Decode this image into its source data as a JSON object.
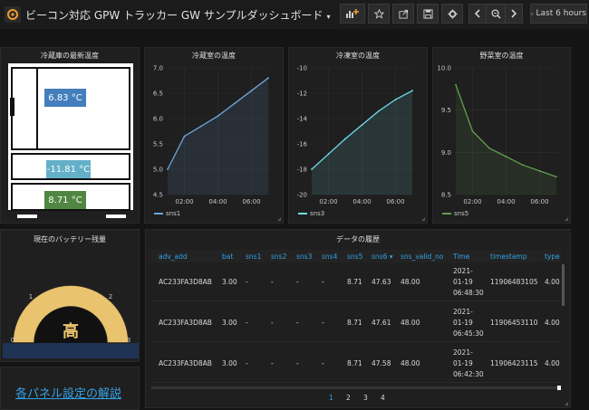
{
  "navbar": {
    "title": "ビーコン対応 GPW トラッカー GW サンプルダッシュボード",
    "caret": "▾",
    "time_range": "Last 6 hours",
    "icons": [
      "add-panel-icon",
      "star-icon",
      "share-icon",
      "save-icon",
      "settings-icon",
      "chevron-left-icon",
      "zoom-out-icon",
      "chevron-right-icon",
      "clock-icon"
    ]
  },
  "fridge": {
    "title": "冷蔵庫の最新温度",
    "fridge_reading": "6.83 °C",
    "freezer_reading": "-11.81 °C",
    "veg_reading": "8.71 °C",
    "colors": {
      "fridge": "#447ebc",
      "freezer": "#64b0c8",
      "veg": "#508642"
    }
  },
  "charts": {
    "fridge": {
      "title": "冷蔵室の温度",
      "yticks": [
        "7.0",
        "6.5",
        "6.0",
        "5.5",
        "5.0",
        "4.5"
      ],
      "xticks": [
        "02:00",
        "04:00",
        "06:00"
      ],
      "legend": "sns1",
      "color": "#6ea6dd"
    },
    "freezer": {
      "title": "冷凍室の温度",
      "yticks": [
        "-10",
        "-12",
        "-14",
        "-16",
        "-18",
        "-20"
      ],
      "xticks": [
        "02:00",
        "04:00",
        "06:00"
      ],
      "legend": "sns3",
      "color": "#70dbed"
    },
    "veg": {
      "title": "野菜室の温度",
      "yticks": [
        "10.0",
        "9.5",
        "9.0",
        "8.5"
      ],
      "xticks": [
        "02:00",
        "04:00",
        "06:00"
      ],
      "legend": "sns5",
      "color": "#629e51"
    }
  },
  "chart_data": [
    {
      "type": "line",
      "title": "冷蔵室の温度",
      "ylim": [
        4.5,
        7.0
      ],
      "x": [
        "01:00",
        "02:00",
        "03:00",
        "04:00",
        "05:00",
        "06:00",
        "06:48"
      ],
      "series": [
        {
          "name": "sns1",
          "values": [
            5.0,
            5.65,
            5.85,
            6.05,
            6.3,
            6.55,
            6.8
          ]
        }
      ]
    },
    {
      "type": "line",
      "title": "冷凍室の温度",
      "ylim": [
        -20,
        -10
      ],
      "x": [
        "01:00",
        "02:00",
        "03:00",
        "04:00",
        "05:00",
        "06:00",
        "06:48"
      ],
      "series": [
        {
          "name": "sns3",
          "values": [
            -18.0,
            -16.8,
            -15.6,
            -14.5,
            -13.4,
            -12.5,
            -11.8
          ]
        }
      ]
    },
    {
      "type": "line",
      "title": "野菜室の温度",
      "ylim": [
        8.5,
        10.0
      ],
      "x": [
        "01:00",
        "02:00",
        "03:00",
        "04:00",
        "05:00",
        "06:00",
        "06:48"
      ],
      "series": [
        {
          "name": "sns5",
          "values": [
            9.8,
            9.25,
            9.05,
            8.95,
            8.85,
            8.78,
            8.71
          ]
        }
      ]
    }
  ],
  "battery": {
    "title": "現在のバッテリー残量",
    "value": "高",
    "ticks": [
      "0",
      "1",
      "2",
      "3"
    ]
  },
  "history": {
    "title": "データの履歴",
    "columns": [
      "adv_add",
      "bat",
      "sns1",
      "sns2",
      "sns3",
      "sns4",
      "sns5",
      "sns6 ▾",
      "sns_valid_no",
      "Time",
      "timestamp",
      "type"
    ],
    "rows": [
      {
        "adv_add": "AC233FA3D8AB",
        "bat": "3.00",
        "sns1": "-",
        "sns2": "-",
        "sns3": "-",
        "sns4": "-",
        "sns5": "8.71",
        "sns6": "47.63",
        "valid": "48.00",
        "time1": "2021-",
        "time2": "01-19",
        "time3": "06:48:30",
        "timestamp": "11906483105",
        "type": "4.00"
      },
      {
        "adv_add": "AC233FA3D8AB",
        "bat": "3.00",
        "sns1": "-",
        "sns2": "-",
        "sns3": "-",
        "sns4": "-",
        "sns5": "8.71",
        "sns6": "47.61",
        "valid": "48.00",
        "time1": "2021-",
        "time2": "01-19",
        "time3": "06:45:30",
        "timestamp": "11906453110",
        "type": "4.00"
      },
      {
        "adv_add": "AC233FA3D8AB",
        "bat": "3.00",
        "sns1": "-",
        "sns2": "-",
        "sns3": "-",
        "sns4": "-",
        "sns5": "8.71",
        "sns6": "47.58",
        "valid": "48.00",
        "time1": "2021-",
        "time2": "01-19",
        "time3": "06:42:30",
        "timestamp": "11906423115",
        "type": "4.00"
      }
    ],
    "pages": [
      "1",
      "2",
      "3",
      "4"
    ],
    "active_page": "1"
  },
  "link": {
    "text": "各パネル設定の解説"
  }
}
